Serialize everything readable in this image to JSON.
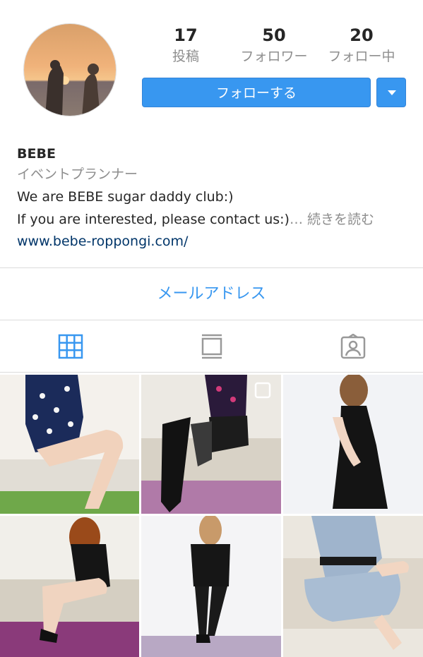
{
  "profile": {
    "name": "BEBE",
    "category": "イベントプランナー",
    "bio_line1": "We are BEBE sugar daddy club:)",
    "bio_line2": "If you are interested, please contact us:)",
    "more_label": "… 続きを読む",
    "website": "www.bebe-roppongi.com/"
  },
  "stats": {
    "posts_count": "17",
    "posts_label": "投稿",
    "followers_count": "50",
    "followers_label": "フォロワー",
    "following_count": "20",
    "following_label": "フォロー中"
  },
  "actions": {
    "follow_label": "フォローする",
    "email_label": "メールアドレス"
  },
  "tabs": [
    {
      "icon": "grid-icon",
      "active": true
    },
    {
      "icon": "feed-icon",
      "active": false
    },
    {
      "icon": "tagged-icon",
      "active": false
    }
  ],
  "colors": {
    "accent": "#3897f0",
    "link": "#003569",
    "muted": "#8e8e8e"
  }
}
